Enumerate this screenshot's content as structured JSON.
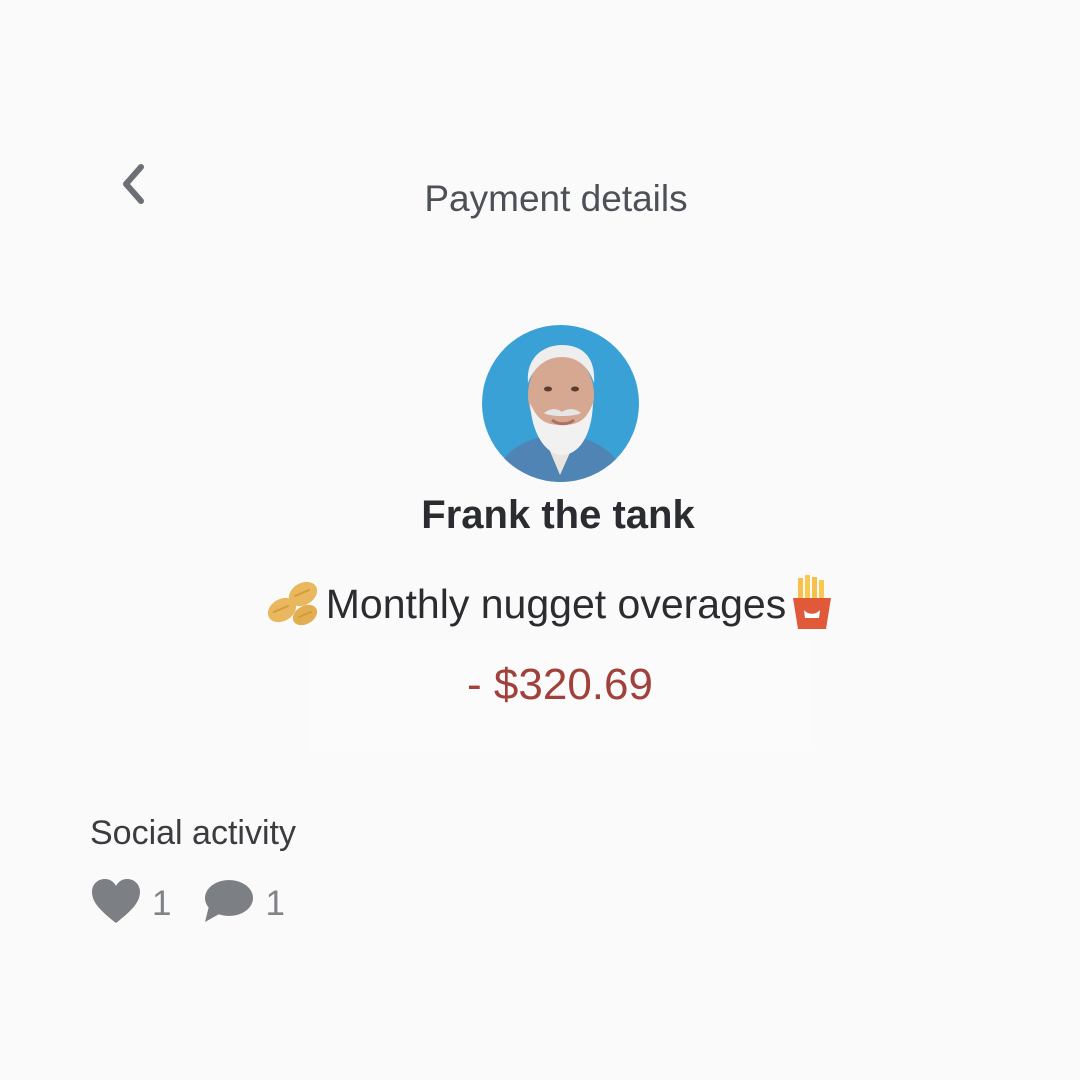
{
  "header": {
    "title": "Payment details",
    "back_icon": "chevron-left-icon"
  },
  "payee": {
    "name": "Frank the tank",
    "avatar": "profile-photo"
  },
  "transaction": {
    "memo": "Monthly nugget overages",
    "memo_leading_icon": "peanuts-icon",
    "memo_trailing_icon": "french-fries-icon",
    "amount": "- $320.69"
  },
  "social": {
    "label": "Social activity",
    "likes": "1",
    "comments": "1",
    "like_icon": "heart-icon",
    "comment_icon": "comment-bubble-icon"
  },
  "colors": {
    "background": "#fafafa",
    "amount_negative": "#a0413c",
    "icon_gray": "#7c7f84"
  }
}
